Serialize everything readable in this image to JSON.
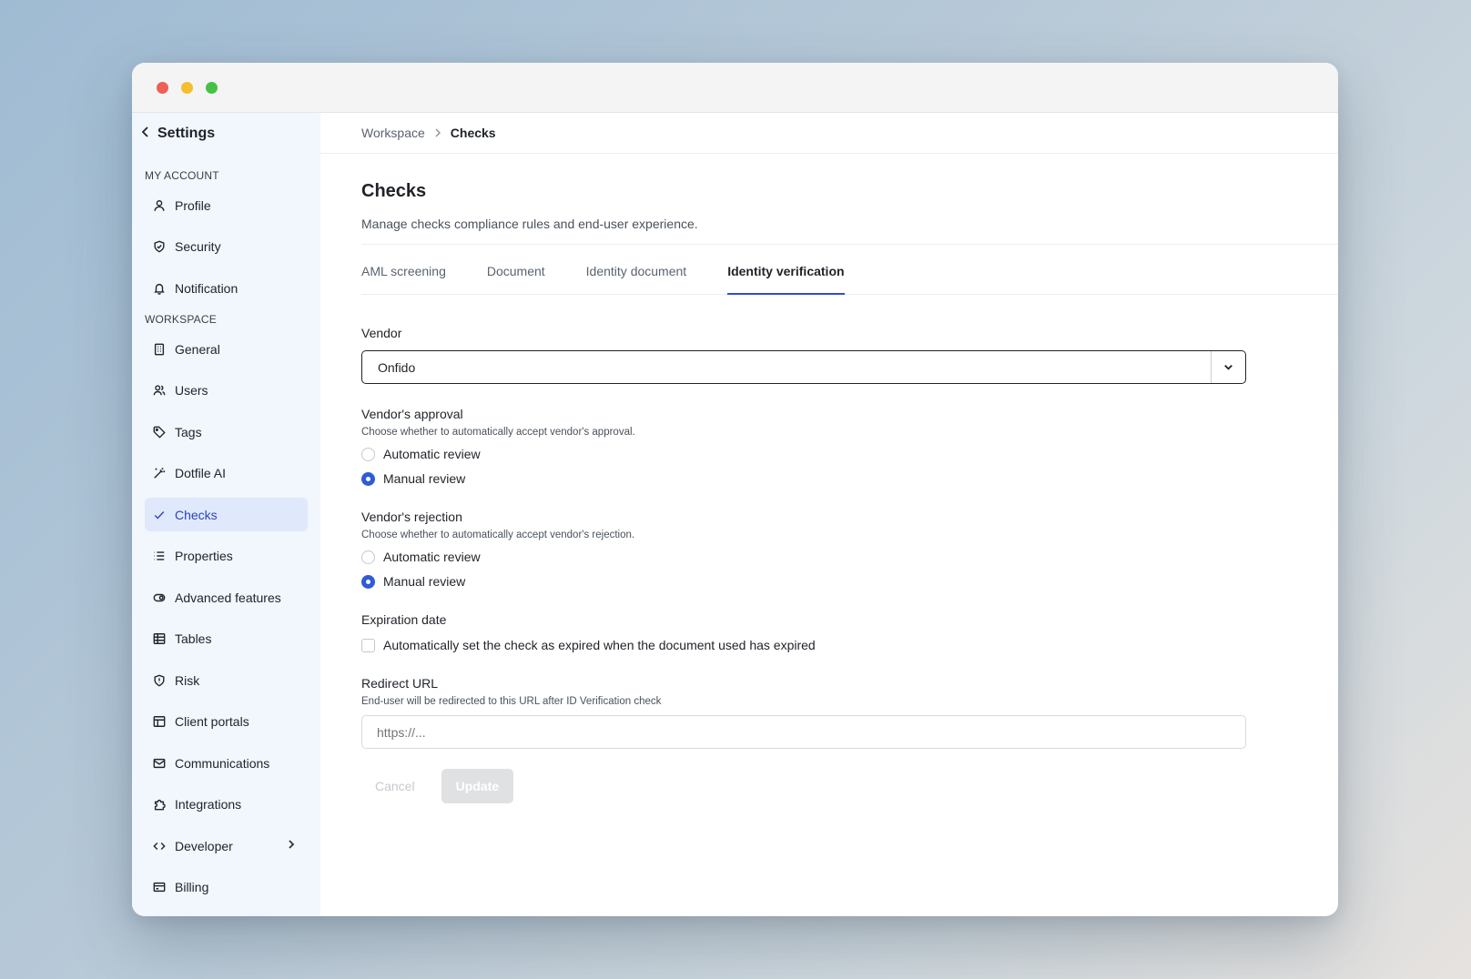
{
  "window_controls": [
    "close",
    "minimize",
    "zoom"
  ],
  "sidebar": {
    "back_label": "Settings",
    "sections": {
      "account": "MY ACCOUNT",
      "workspace": "WORKSPACE"
    },
    "account_items": [
      {
        "label": "Profile",
        "icon": "user-icon"
      },
      {
        "label": "Security",
        "icon": "shield-check-icon"
      },
      {
        "label": "Notification",
        "icon": "bell-icon"
      }
    ],
    "workspace_items": [
      {
        "label": "General",
        "icon": "building-icon"
      },
      {
        "label": "Users",
        "icon": "users-icon"
      },
      {
        "label": "Tags",
        "icon": "tag-icon"
      },
      {
        "label": "Dotfile AI",
        "icon": "magic-wand-icon"
      },
      {
        "label": "Checks",
        "icon": "check-icon",
        "active": true
      },
      {
        "label": "Properties",
        "icon": "list-icon"
      },
      {
        "label": "Advanced features",
        "icon": "toggle-icon"
      },
      {
        "label": "Tables",
        "icon": "table-icon"
      },
      {
        "label": "Risk",
        "icon": "shield-alert-icon"
      },
      {
        "label": "Client portals",
        "icon": "layout-icon"
      },
      {
        "label": "Communications",
        "icon": "mail-icon"
      },
      {
        "label": "Integrations",
        "icon": "puzzle-icon"
      },
      {
        "label": "Developer",
        "icon": "code-icon",
        "expandable": true
      },
      {
        "label": "Billing",
        "icon": "wallet-icon"
      }
    ]
  },
  "breadcrumb": {
    "parent": "Workspace",
    "current": "Checks"
  },
  "page": {
    "title": "Checks",
    "subtitle": "Manage checks compliance rules and end-user experience."
  },
  "tabs": [
    {
      "label": "AML screening",
      "active": false
    },
    {
      "label": "Document",
      "active": false
    },
    {
      "label": "Identity document",
      "active": false
    },
    {
      "label": "Identity verification",
      "active": true
    }
  ],
  "form": {
    "vendor": {
      "label": "Vendor",
      "value": "Onfido"
    },
    "approval": {
      "label": "Vendor's approval",
      "help": "Choose whether to automatically accept vendor's approval.",
      "options": [
        "Automatic review",
        "Manual review"
      ],
      "selected": "Manual review"
    },
    "rejection": {
      "label": "Vendor's rejection",
      "help": "Choose whether to automatically accept vendor's rejection.",
      "options": [
        "Automatic review",
        "Manual review"
      ],
      "selected": "Manual review"
    },
    "expiration": {
      "label": "Expiration date",
      "checkbox_label": "Automatically set the check as expired when the document used has expired",
      "checked": false
    },
    "redirect": {
      "label": "Redirect URL",
      "help": "End-user will be redirected to this URL after ID Verification check",
      "placeholder": "https://..."
    },
    "actions": {
      "cancel": "Cancel",
      "update": "Update"
    }
  },
  "colors": {
    "accent": "#2f5bd6",
    "sidebar_bg": "#f2f6fd",
    "active_item_bg": "#e0e9fb"
  }
}
